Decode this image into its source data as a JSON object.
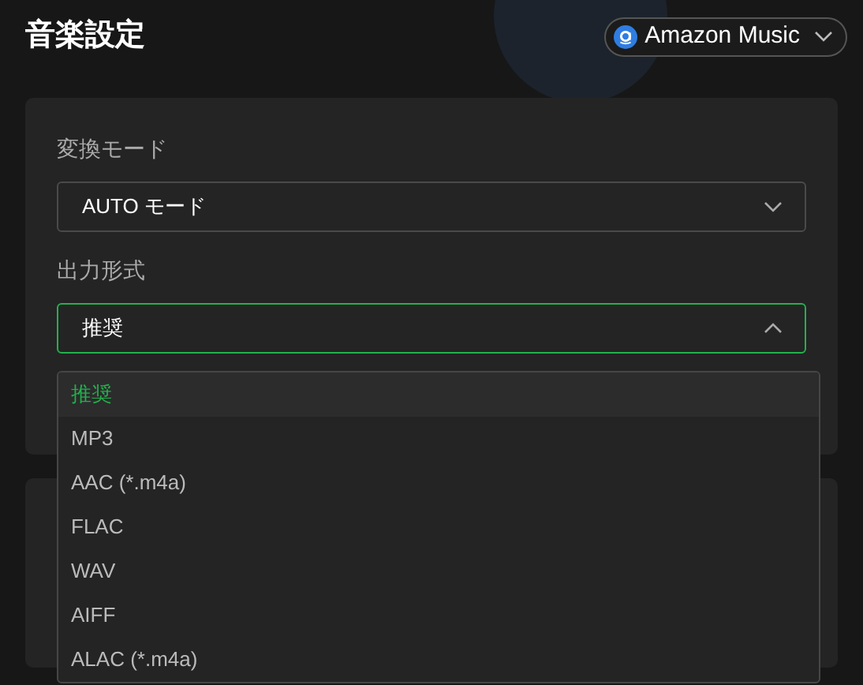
{
  "title": "音楽設定",
  "source_button": {
    "label": "Amazon Music"
  },
  "settings": [
    {
      "label": "変換モード",
      "value": "AUTO モード",
      "expanded": false
    },
    {
      "label": "出力形式",
      "value": "推奨",
      "expanded": true
    }
  ],
  "dropdown_options": [
    {
      "label": "推奨",
      "selected": true
    },
    {
      "label": "MP3",
      "selected": false
    },
    {
      "label": "AAC (*.m4a)",
      "selected": false
    },
    {
      "label": "FLAC",
      "selected": false
    },
    {
      "label": "WAV",
      "selected": false
    },
    {
      "label": "AIFF",
      "selected": false
    },
    {
      "label": "ALAC (*.m4a)",
      "selected": false
    }
  ]
}
